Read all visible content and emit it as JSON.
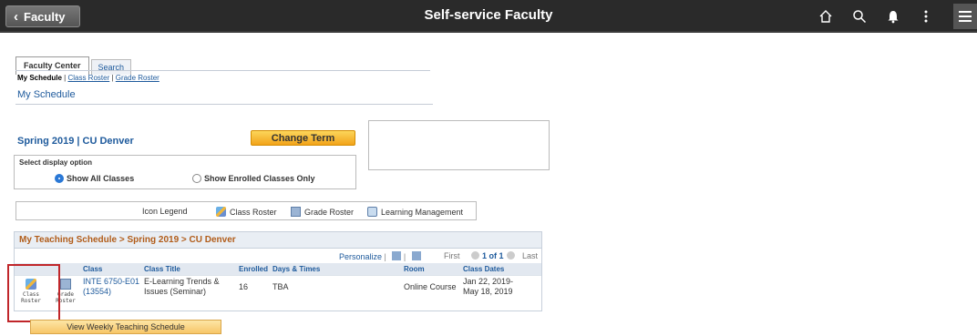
{
  "header": {
    "back_label": "Faculty",
    "title": "Self-service Faculty",
    "icons": [
      "home-icon",
      "search-icon",
      "bell-icon",
      "more-vertical-icon",
      "hamburger-menu-icon"
    ]
  },
  "tabs": [
    {
      "label": "Faculty Center",
      "active": true
    },
    {
      "label": "Search",
      "active": false
    }
  ],
  "subnav": {
    "current": "My Schedule",
    "sep": "|",
    "links": [
      "Class Roster",
      "Grade Roster"
    ]
  },
  "page_heading": "My Schedule",
  "term": {
    "label": "Spring 2019 | CU Denver",
    "change_button": "Change Term"
  },
  "display_options": {
    "label": "Select display option",
    "all_classes": "Show All Classes",
    "enrolled_only": "Show Enrolled Classes Only",
    "selected": "Show All Classes"
  },
  "legend": {
    "title": "Icon Legend",
    "items": [
      "Class Roster",
      "Grade Roster",
      "Learning Management"
    ]
  },
  "schedule": {
    "title": "My Teaching Schedule > Spring 2019 > CU Denver",
    "personalize": "Personalize",
    "first": "First",
    "page_info": "1 of 1",
    "last": "Last",
    "columns": [
      "Class",
      "Class Title",
      "Enrolled",
      "Days & Times",
      "Room",
      "Class Dates"
    ],
    "row": {
      "class_roster_btn": "Class Roster",
      "grade_roster_btn": "Grade Roster",
      "class_code": "INTE 6750-E01",
      "class_number": "(13554)",
      "title_line1": "E-Learning Trends &",
      "title_line2": "Issues (Seminar)",
      "enrolled": "16",
      "days_times": "TBA",
      "room": "Online Course",
      "dates_line1": "Jan 22, 2019-",
      "dates_line2": "May 18, 2019"
    }
  },
  "weekly_button": "View Weekly Teaching Schedule",
  "colors": {
    "header_bg": "#2a2a2a",
    "link_blue": "#1e5a9c",
    "grid_title_orange": "#b15c19",
    "change_term_yellow": "#f2a31a",
    "highlight_red": "#c0262a"
  }
}
